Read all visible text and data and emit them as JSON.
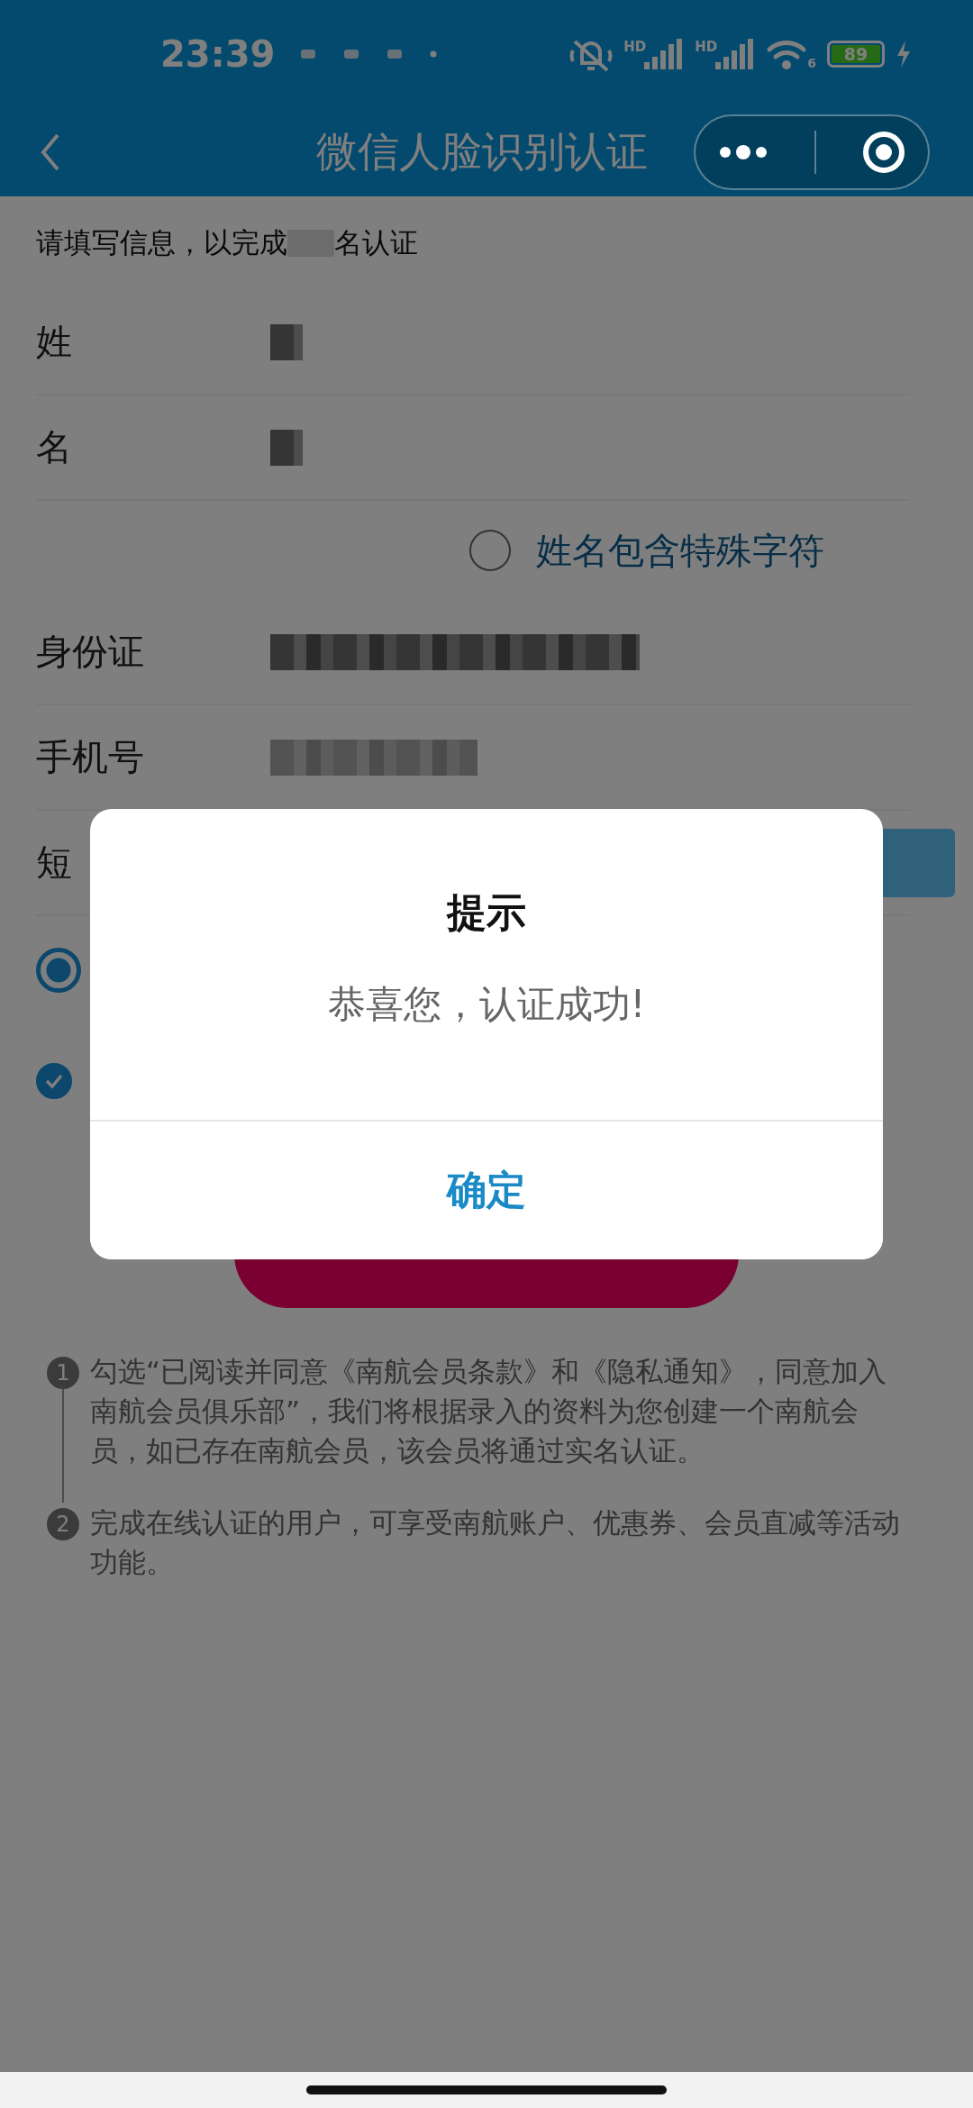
{
  "status_bar": {
    "time": "23:39",
    "signal_labels": [
      "HD",
      "HD"
    ],
    "wifi_label": "6",
    "battery": "89",
    "charging": true
  },
  "nav": {
    "title": "微信人脸识别认证"
  },
  "form": {
    "intro_parts": [
      "请填写信息，以完成",
      "名认证"
    ],
    "fields": [
      {
        "kind": "redacted",
        "label": "姓"
      },
      {
        "kind": "redacted",
        "label": "名"
      },
      {
        "kind": "option",
        "label": "姓名包含特殊字符",
        "checked": false
      },
      {
        "kind": "redacted",
        "label": "身份证"
      },
      {
        "kind": "redacted",
        "label": "手机号"
      },
      {
        "kind": "sms",
        "label": "短"
      }
    ],
    "radio": {
      "selected": true
    },
    "agreement": {
      "checked": true
    }
  },
  "notes": [
    {
      "number": "1",
      "text": "勾选“已阅读并同意《南航会员条款》和《隐私通知》，同意加入南航会员俱乐部”，我们将根据录入的资料为您创建一个南航会员，如已存在南航会员，该会员将通过实名认证。"
    },
    {
      "number": "2",
      "text": "完成在线认证的用户，可享受南航账户、优惠券、会员直减等活动功能。"
    }
  ],
  "dialog": {
    "title": "提示",
    "message": "恭喜您，认证成功!",
    "confirm": "确定"
  }
}
